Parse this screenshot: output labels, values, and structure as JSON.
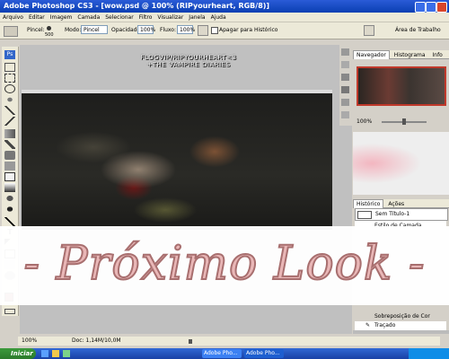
{
  "window": {
    "title": "Adobe Photoshop CS3 - [wow.psd @ 100% (RIPyourheart, RGB/8)]"
  },
  "menu": [
    "Arquivo",
    "Editar",
    "Imagem",
    "Camada",
    "Selecionar",
    "Filtro",
    "Visualizar",
    "Janela",
    "Ajuda"
  ],
  "options": {
    "brush_label": "Pincel:",
    "brush_size": "500",
    "mode_label": "Modo:",
    "mode_value": "Pincel",
    "opacity_label": "Opacidade:",
    "opacity_value": "100%",
    "flow_label": "Fluxo:",
    "flow_value": "100%",
    "erase_history_label": "Apagar para Histórico",
    "workspace_label": "Área de Trabalho"
  },
  "canvas": {
    "watermark_line1": "FLOGVIP/RIPYOURHEART<3",
    "watermark_line2": "+THE VAMPIRE DIARIES"
  },
  "navigator": {
    "tabs": [
      "Navegador",
      "Histograma",
      "Info"
    ],
    "zoom": "100%"
  },
  "history": {
    "tabs": [
      "Histórico",
      "Ações"
    ],
    "snapshot": "Sem Título-1",
    "items": [
      "Estilo de Camada",
      "Sobreposição de Cor",
      "Traçado"
    ]
  },
  "banner": {
    "text": "- Próximo Look -"
  },
  "status": {
    "zoom": "100%",
    "doc": "Doc: 1,14M/10,0M"
  },
  "taskbar": {
    "start": "Iniciar",
    "item1": "Adobe Pho...",
    "item2": "Adobe Pho..."
  }
}
